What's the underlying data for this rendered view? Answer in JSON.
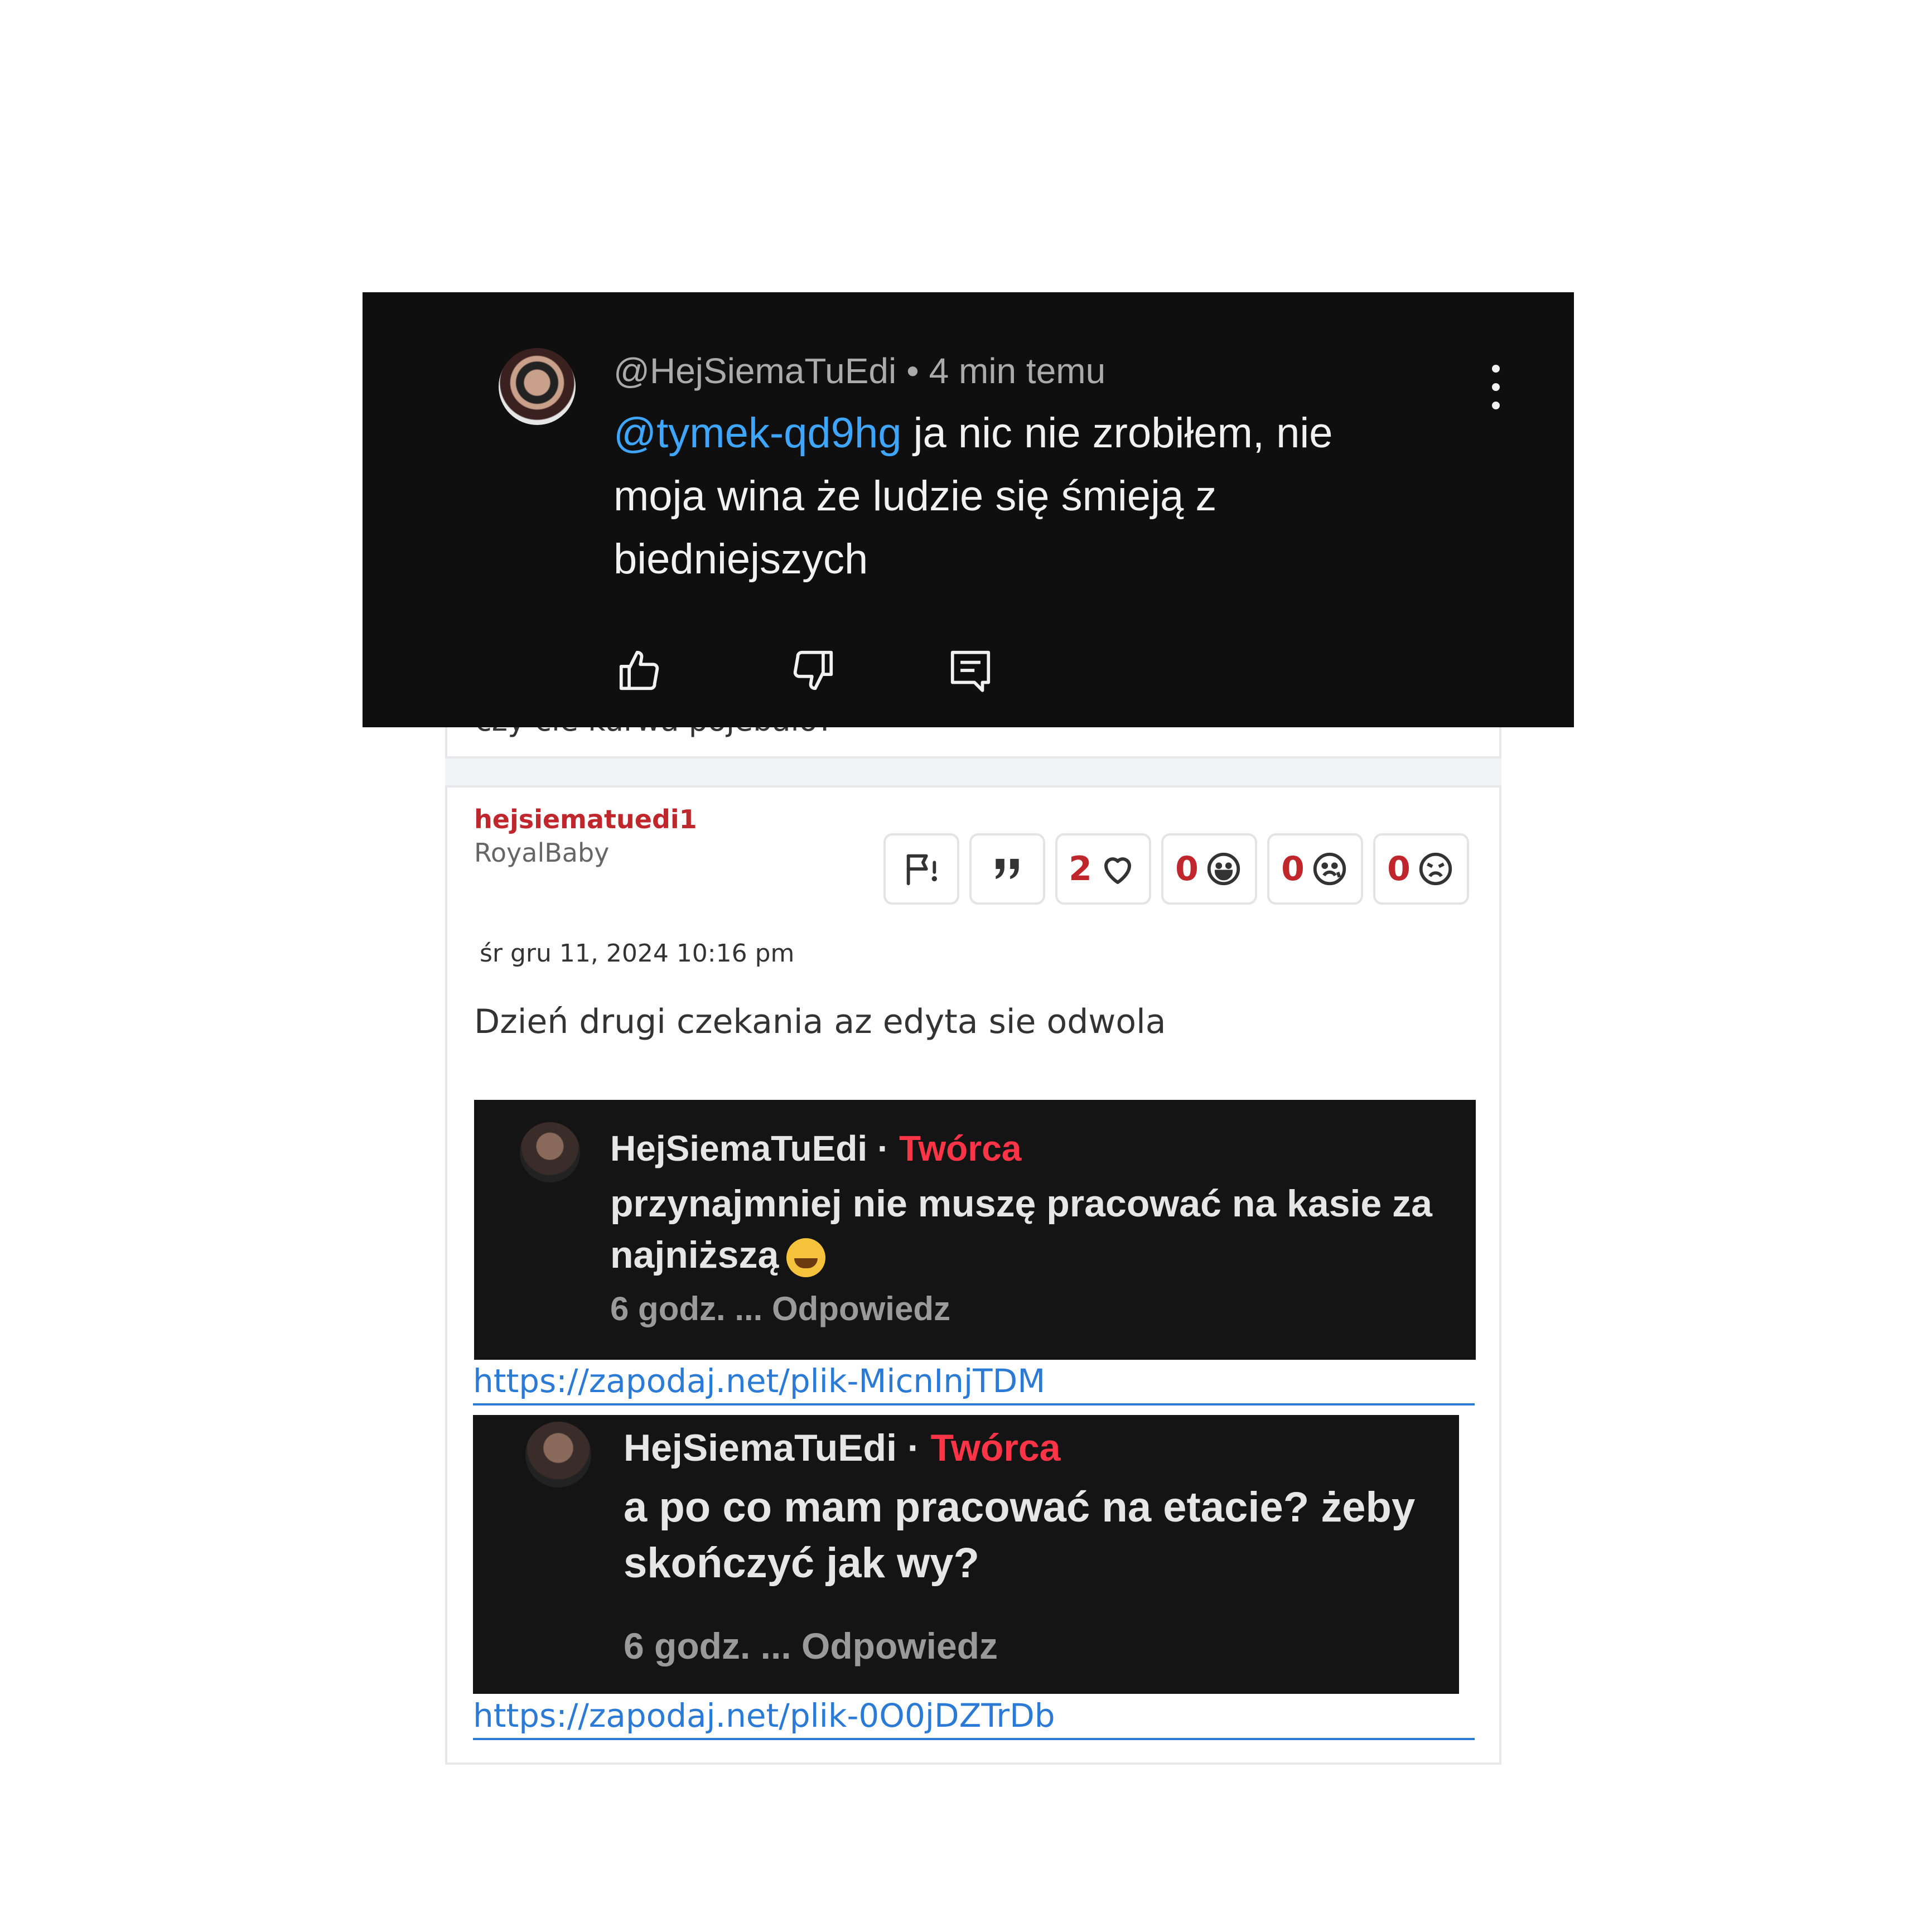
{
  "youtube_comment": {
    "author": "@HejSiemaTuEdi",
    "separator": "•",
    "time": "4 min temu",
    "mention": "@tymek-qd9hg",
    "text": " ja nic nie zrobiłem, nie moja wina że ludzie się śmieją z biedniejszych",
    "icons": [
      "thumbs-up-icon",
      "thumbs-down-icon",
      "reply-icon",
      "more-vert-icon"
    ]
  },
  "forum": {
    "previous_post_tail": "czy cie kurwa pojebalo?",
    "post": {
      "author": "hejsiematuedi1",
      "rank": "RoyalBaby",
      "date": "śr gru 11, 2024 10:16 pm",
      "body": "Dzień drugi czekania az edyta sie odwola",
      "actions": {
        "report_icon": "flag-icon",
        "quote_icon": "quote-icon",
        "likes": "2",
        "laugh_count": "0",
        "sad_count": "0",
        "angry_count": "0"
      },
      "embedded_comments": [
        {
          "author": "HejSiemaTuEdi",
          "dot": "·",
          "badge": "Twórca",
          "text": "przynajmniej nie muszę pracować na kasie za najniższą",
          "meta": "6 godz. ... Odpowiedz",
          "link": "https://zapodaj.net/plik-MicnInjTDM"
        },
        {
          "author": "HejSiemaTuEdi",
          "dot": "·",
          "badge": "Twórca",
          "text": "a po co mam pracować na etacie? żeby skończyć jak wy?",
          "meta": "6 godz. ... Odpowiedz",
          "link": "https://zapodaj.net/plik-0O0jDZTrDb"
        }
      ]
    }
  },
  "colors": {
    "author_red": "#c0272d",
    "link_blue": "#2a7ad6",
    "mention_blue": "#3ea6ff",
    "creator_badge": "#ff3547",
    "dark_bg": "#0f0f0f"
  }
}
